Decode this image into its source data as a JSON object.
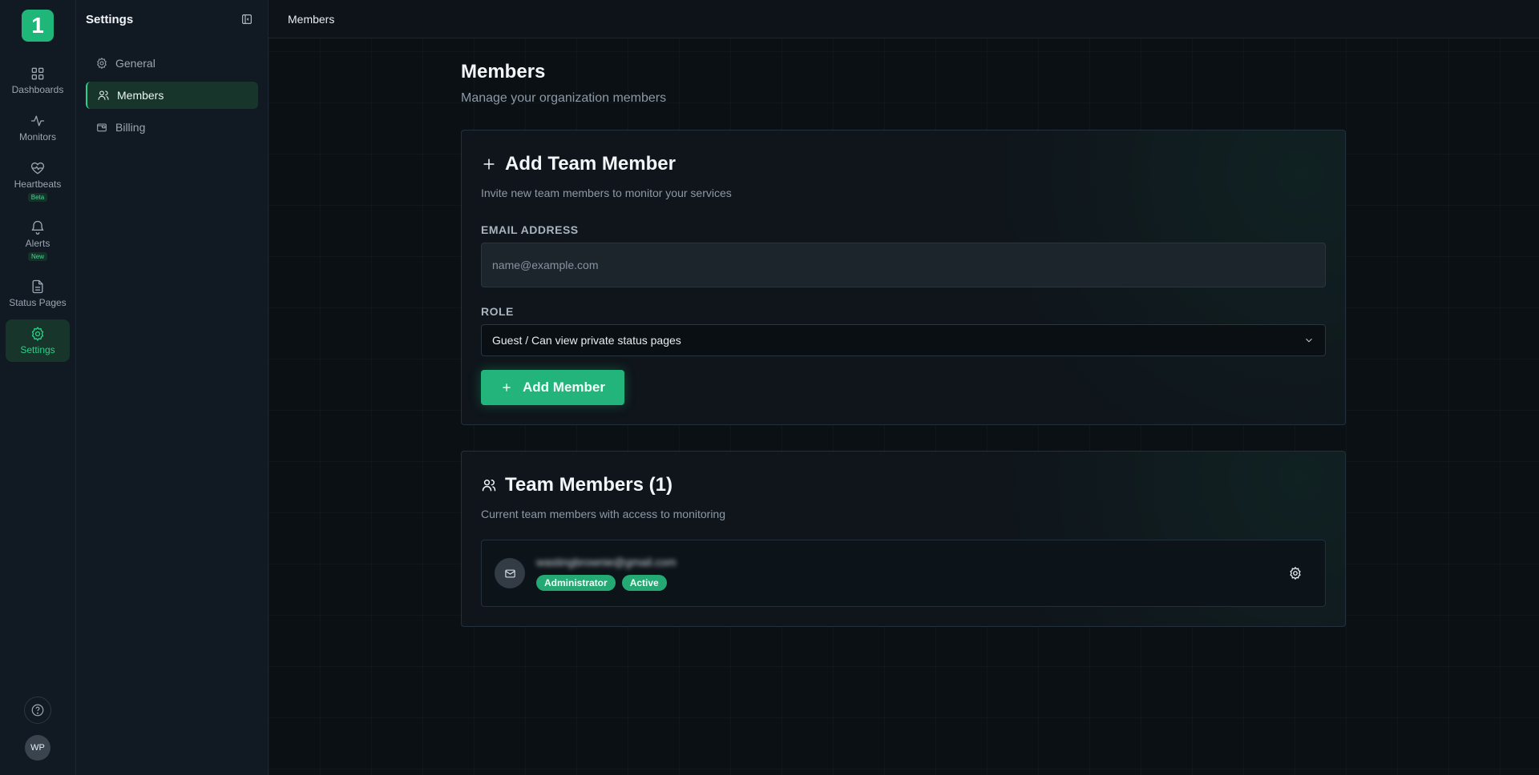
{
  "rail": {
    "logo_text": "1",
    "items": [
      {
        "label": "Dashboards",
        "icon": "dashboard-icon",
        "badge": ""
      },
      {
        "label": "Monitors",
        "icon": "activity-icon",
        "badge": ""
      },
      {
        "label": "Heartbeats",
        "icon": "heartbeat-icon",
        "badge": "Beta"
      },
      {
        "label": "Alerts",
        "icon": "bell-icon",
        "badge": "New"
      },
      {
        "label": "Status Pages",
        "icon": "file-icon",
        "badge": ""
      },
      {
        "label": "Settings",
        "icon": "gear-icon",
        "badge": ""
      }
    ],
    "avatar_initials": "WP"
  },
  "sidebar": {
    "title": "Settings",
    "items": [
      {
        "label": "General"
      },
      {
        "label": "Members"
      },
      {
        "label": "Billing"
      }
    ]
  },
  "topbar": {
    "breadcrumb": "Members"
  },
  "page": {
    "title": "Members",
    "subtitle": "Manage your organization members"
  },
  "add_card": {
    "title": "Add Team Member",
    "subtitle": "Invite new team members to monitor your services",
    "email_label": "EMAIL ADDRESS",
    "email_placeholder": "name@example.com",
    "role_label": "ROLE",
    "role_value": "Guest / Can view private status pages",
    "submit_label": "Add Member"
  },
  "members_card": {
    "title": "Team Members (1)",
    "subtitle": "Current team members with access to monitoring",
    "members": [
      {
        "email": "wastingbrownie@gmail.com",
        "role_badge": "Administrator",
        "status_badge": "Active"
      }
    ]
  },
  "colors": {
    "accent": "#22b47a",
    "background": "#0b1015",
    "sidebar": "#111a22"
  }
}
